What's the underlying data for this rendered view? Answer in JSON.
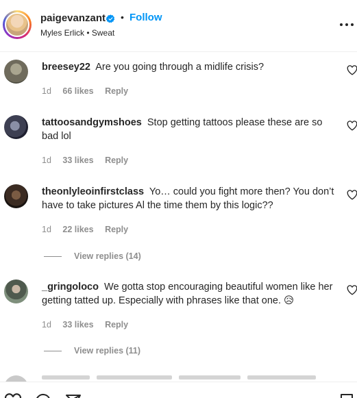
{
  "header": {
    "username": "paigevanzant",
    "separator": "•",
    "follow_label": "Follow",
    "subtitle": "Myles Erlick • Sweat"
  },
  "comments": [
    {
      "username": "breesey22",
      "text": "Are you going through a midlife crisis?",
      "time": "1d",
      "likes": "66 likes",
      "reply_label": "Reply"
    },
    {
      "username": "tattoosandgymshoes",
      "text": "Stop getting tattoos please these are so bad lol",
      "time": "1d",
      "likes": "33 likes",
      "reply_label": "Reply"
    },
    {
      "username": "theonlyleoinfirstclass",
      "text": "Yo… could you fight more then? You don’t have to take pictures Al the time them by this logic??",
      "time": "1d",
      "likes": "22 likes",
      "reply_label": "Reply",
      "view_replies": "View replies (14)"
    },
    {
      "username": "_gringoloco",
      "text": "We gotta stop encouraging beautiful women like her getting tatted up. Especially with phrases like that one. 😥",
      "time": "1d",
      "likes": "33 likes",
      "reply_label": "Reply",
      "view_replies": "View replies (11)"
    }
  ],
  "colors": {
    "accent": "#0095f6",
    "text": "#262626",
    "muted": "#8e8e8e",
    "divider": "#efefef"
  },
  "icons": [
    "verified-badge-icon",
    "more-options-icon",
    "heart-icon",
    "comment-icon",
    "share-icon",
    "bookmark-icon"
  ]
}
